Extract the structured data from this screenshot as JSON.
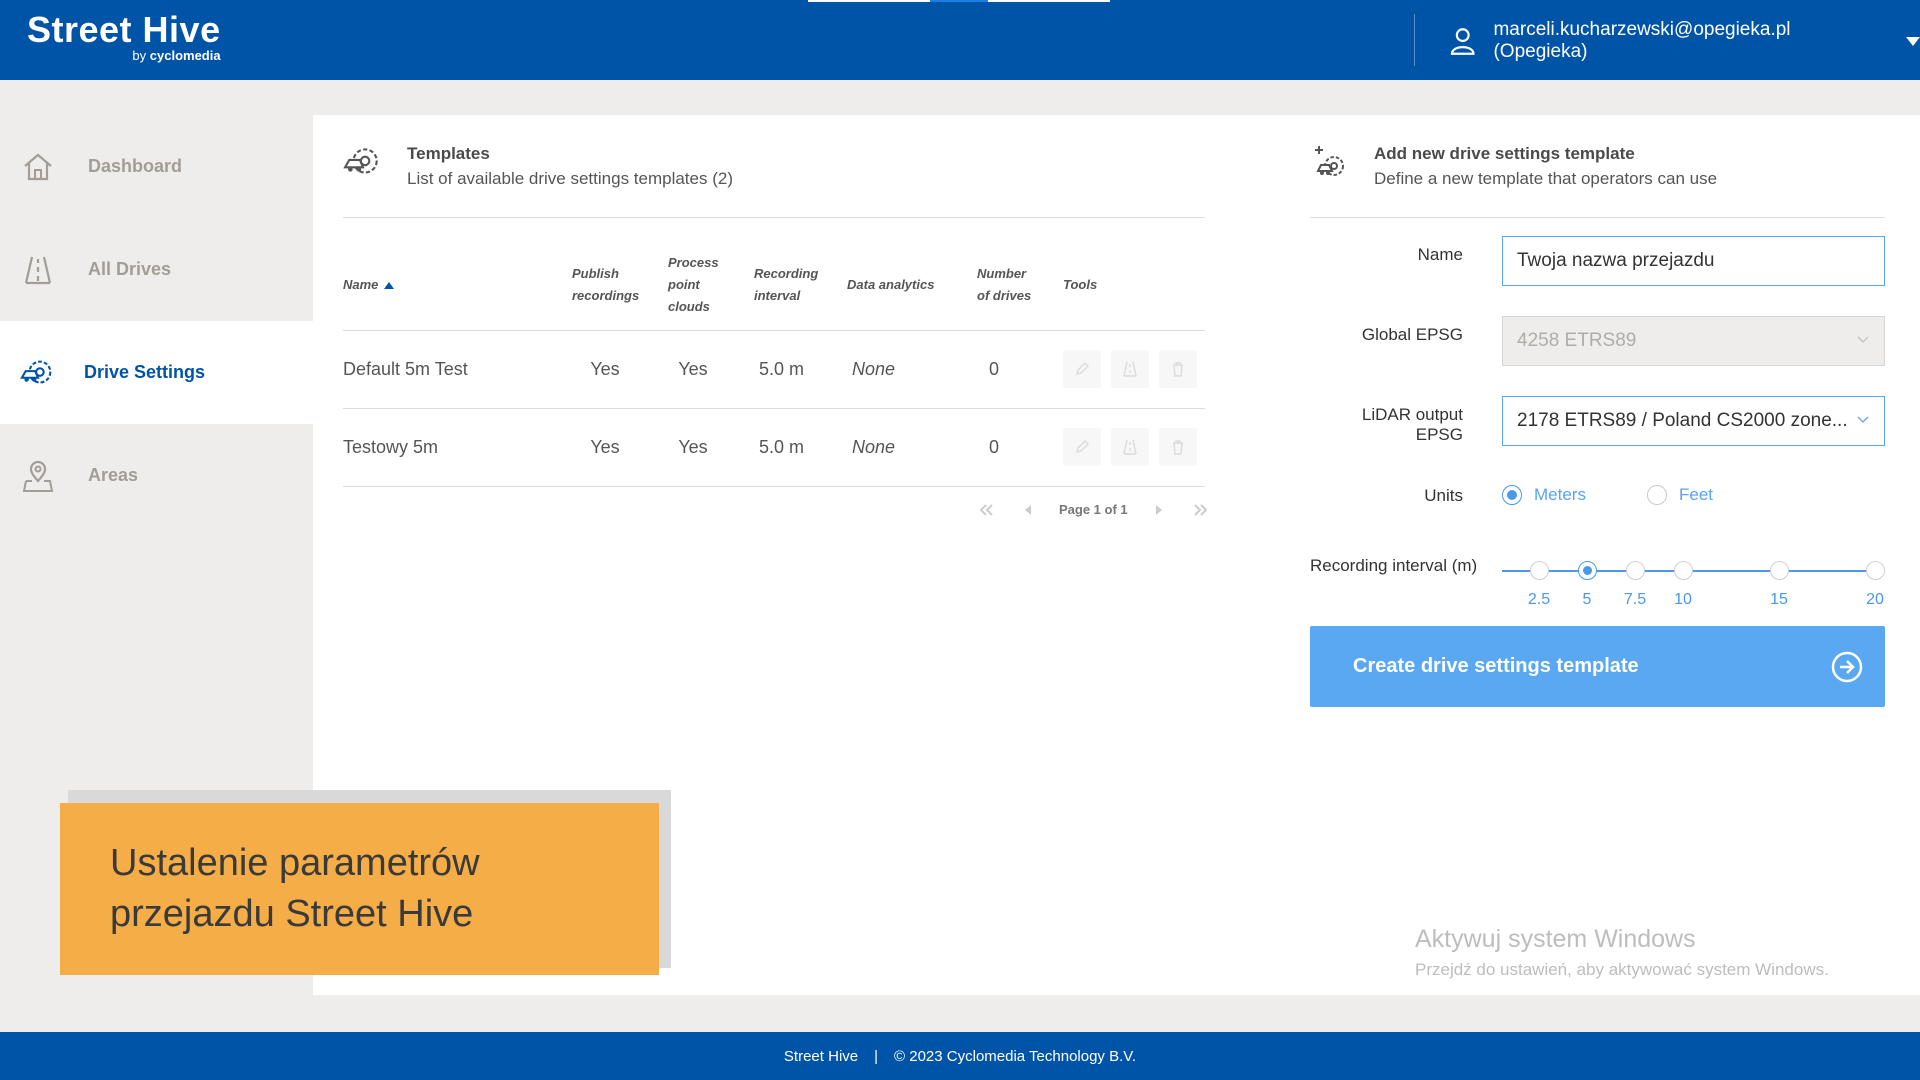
{
  "header": {
    "logo_main": "Street Hive",
    "logo_sub_prefix": "by ",
    "logo_sub_brand": "cyclomedia",
    "user": "marceli.kucharzewski@opegieka.pl (Opegieka)"
  },
  "sidebar": {
    "items": [
      {
        "label": "Dashboard",
        "icon": "home-icon",
        "active": false
      },
      {
        "label": "All Drives",
        "icon": "road-icon",
        "active": false
      },
      {
        "label": "Drive Settings",
        "icon": "car-settings-icon",
        "active": true
      },
      {
        "label": "Areas",
        "icon": "map-pin-icon",
        "active": false
      }
    ]
  },
  "templates": {
    "title": "Templates",
    "subtitle": "List of available drive settings templates (2)",
    "columns": {
      "name": "Name",
      "publish_l1": "Publish",
      "publish_l2": "recordings",
      "process_l1": "Process",
      "process_l2": "point",
      "process_l3": "clouds",
      "interval_l1": "Recording",
      "interval_l2": "interval",
      "analytics": "Data analytics",
      "drives_l1": "Number",
      "drives_l2": "of drives",
      "tools": "Tools"
    },
    "rows": [
      {
        "name": "Default 5m Test",
        "publish": "Yes",
        "process": "Yes",
        "interval": "5.0 m",
        "analytics": "None",
        "drives": "0"
      },
      {
        "name": "Testowy 5m",
        "publish": "Yes",
        "process": "Yes",
        "interval": "5.0 m",
        "analytics": "None",
        "drives": "0"
      }
    ],
    "pager": "Page 1 of 1"
  },
  "add_template": {
    "title": "Add new drive settings template",
    "subtitle": "Define a new template that operators can use",
    "name_label": "Name",
    "name_value": "Twoja nazwa przejazdu",
    "global_epsg_label": "Global EPSG",
    "global_epsg_value": "4258 ETRS89",
    "lidar_epsg_label": "LiDAR output EPSG",
    "lidar_epsg_value": "2178 ETRS89 / Poland CS2000 zone...",
    "units_label": "Units",
    "units_options": [
      "Meters",
      "Feet"
    ],
    "units_selected": "Meters",
    "interval_label": "Recording interval (m)",
    "interval_options": [
      "2.5",
      "5",
      "7.5",
      "10",
      "15",
      "20"
    ],
    "interval_selected": "5",
    "create_label": "Create drive settings template"
  },
  "caption": {
    "line1": "Ustalenie parametrów",
    "line2": "przejazdu Street Hive"
  },
  "watermark": {
    "line1": "Aktywuj system Windows",
    "line2": "Przejdź do ustawień, aby aktywować system Windows."
  },
  "footer": {
    "app": "Street Hive",
    "separator": "|",
    "copyright": "© 2023 Cyclomedia Technology B.V."
  },
  "colors": {
    "brand_blue": "#0054a8",
    "accent_blue": "#5aa8f2",
    "caption_orange": "#f5ad47"
  }
}
